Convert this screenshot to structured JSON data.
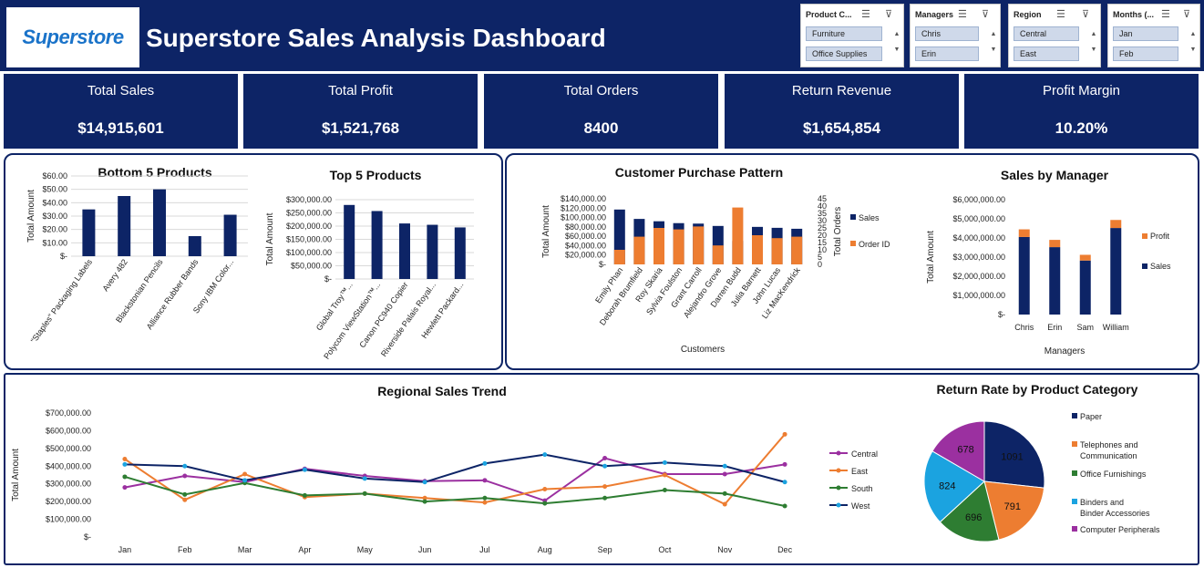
{
  "header": {
    "logo_text": "Superstore",
    "title": "Superstore Sales Analysis Dashboard"
  },
  "slicers": [
    {
      "title": "Product C...",
      "items": [
        "Furniture",
        "Office Supplies"
      ]
    },
    {
      "title": "Managers",
      "items": [
        "Chris",
        "Erin"
      ]
    },
    {
      "title": "Region",
      "items": [
        "Central",
        "East"
      ]
    },
    {
      "title": "Months (...",
      "items": [
        "Jan",
        "Feb"
      ]
    }
  ],
  "kpis": [
    {
      "label": "Total Sales",
      "value": "$14,915,601"
    },
    {
      "label": "Total Profit",
      "value": "$1,521,768"
    },
    {
      "label": "Total Orders",
      "value": "8400"
    },
    {
      "label": "Return Revenue",
      "value": "$1,654,854"
    },
    {
      "label": "Profit Margin",
      "value": "10.20%"
    }
  ],
  "colors": {
    "navy": "#0d2466",
    "bar": "#0d2466",
    "orange": "#ed7d31",
    "purple": "#9b30a0",
    "green": "#2e7d32",
    "sky": "#1ba3e0"
  },
  "chart_data": [
    {
      "id": "bottom5",
      "type": "bar",
      "title": "Bottom 5 Products",
      "ylabel": "Total Amount",
      "xlabel": "",
      "categories": [
        "\"Staples\" Packaging Labels",
        "Avery 482",
        "Blackstonian Pencils",
        "Alliance Rubber Bands",
        "Sony IBM Color..."
      ],
      "values": [
        35,
        45,
        50,
        15,
        31
      ],
      "ylim": [
        0,
        60
      ],
      "ticks": [
        "$-",
        "$10.00",
        "$20.00",
        "$30.00",
        "$40.00",
        "$50.00",
        "$60.00"
      ],
      "grid": true
    },
    {
      "id": "top5",
      "type": "bar",
      "title": "Top 5 Products",
      "ylabel": "Total Amount",
      "xlabel": "",
      "categories": [
        "Global Troy™...",
        "Polycom ViewStation™...",
        "Canon PC940 Copier",
        "Riverside Palais Royal...",
        "Hewlett Packard..."
      ],
      "values": [
        280000,
        257000,
        210000,
        205000,
        195000
      ],
      "ylim": [
        0,
        300000
      ],
      "ticks": [
        "$-",
        "$50,000.00",
        "$100,000.00",
        "$150,000.00",
        "$200,000.00",
        "$250,000.00",
        "$300,000.00"
      ],
      "grid": true
    },
    {
      "id": "customers",
      "type": "bar",
      "title": "Customer Purchase Pattern",
      "xlabel": "Customers",
      "ylabel": "Total Amount",
      "y2label": "Total Orders",
      "categories": [
        "Emily Phan",
        "Deborah Brumfield",
        "Roy Skaria",
        "Sylvia Foulston",
        "Grant Carroll",
        "Alejandro Grove",
        "Darren Budd",
        "Julia Barnett",
        "John Lucas",
        "Liz MacKendrick"
      ],
      "series": [
        {
          "name": "Sales",
          "axis": "left",
          "values": [
            117000,
            97000,
            92000,
            88000,
            87000,
            82000,
            50000,
            80000,
            78000,
            76000
          ]
        },
        {
          "name": "Order ID",
          "axis": "right",
          "values": [
            10,
            19,
            25,
            24,
            26,
            13,
            39,
            20,
            18,
            19
          ]
        }
      ],
      "ylim": [
        0,
        140000
      ],
      "y2lim": [
        0,
        45
      ],
      "ticks": [
        "$-",
        "$20,000.00",
        "$40,000.00",
        "$60,000.00",
        "$80,000.00",
        "$100,000.00",
        "$120,000.00",
        "$140,000.00"
      ],
      "ticks2": [
        "0",
        "5",
        "10",
        "15",
        "20",
        "25",
        "30",
        "35",
        "40",
        "45"
      ],
      "legend": "right"
    },
    {
      "id": "managers",
      "type": "bar",
      "title": "Sales by Manager",
      "xlabel": "Managers",
      "ylabel": "Total Amount",
      "categories": [
        "Chris",
        "Erin",
        "Sam",
        "William"
      ],
      "series": [
        {
          "name": "Sales",
          "values": [
            4050000,
            3520000,
            2820000,
            4520000
          ]
        },
        {
          "name": "Profit",
          "values": [
            400000,
            380000,
            300000,
            420000
          ]
        }
      ],
      "ylim": [
        0,
        6000000
      ],
      "ticks": [
        "$-",
        "$1,000,000.00",
        "$2,000,000.00",
        "$3,000,000.00",
        "$4,000,000.00",
        "$5,000,000.00",
        "$6,000,000.00"
      ],
      "legend": "right"
    },
    {
      "id": "regional",
      "type": "line",
      "title": "Regional Sales Trend",
      "xlabel": "",
      "ylabel": "Total Amount",
      "categories": [
        "Jan",
        "Feb",
        "Mar",
        "Apr",
        "May",
        "Jun",
        "Jul",
        "Aug",
        "Sep",
        "Oct",
        "Nov",
        "Dec"
      ],
      "series": [
        {
          "name": "Central",
          "values": [
            280000,
            345000,
            310000,
            385000,
            345000,
            315000,
            320000,
            205000,
            445000,
            355000,
            355000,
            410000
          ]
        },
        {
          "name": "East",
          "values": [
            440000,
            210000,
            355000,
            225000,
            245000,
            220000,
            195000,
            270000,
            285000,
            350000,
            185000,
            580000
          ]
        },
        {
          "name": "South",
          "values": [
            340000,
            240000,
            305000,
            235000,
            245000,
            200000,
            220000,
            190000,
            220000,
            265000,
            245000,
            175000
          ]
        },
        {
          "name": "West",
          "values": [
            410000,
            400000,
            320000,
            380000,
            330000,
            310000,
            415000,
            465000,
            400000,
            420000,
            400000,
            310000
          ]
        }
      ],
      "ylim": [
        0,
        700000
      ],
      "ticks": [
        "$-",
        "$100,000.00",
        "$200,000.00",
        "$300,000.00",
        "$400,000.00",
        "$500,000.00",
        "$600,000.00",
        "$700,000.00"
      ],
      "legend": "right"
    },
    {
      "id": "returns",
      "type": "pie",
      "title": "Return Rate by Product Category",
      "slices": [
        {
          "name": "Paper",
          "value": 1091
        },
        {
          "name": "Telephones and Communication",
          "value": 791
        },
        {
          "name": "Office Furnishings",
          "value": 696
        },
        {
          "name": "Binders and Binder Accessories",
          "value": 824
        },
        {
          "name": "Computer Peripherals",
          "value": 678
        }
      ],
      "legend": "right"
    }
  ]
}
